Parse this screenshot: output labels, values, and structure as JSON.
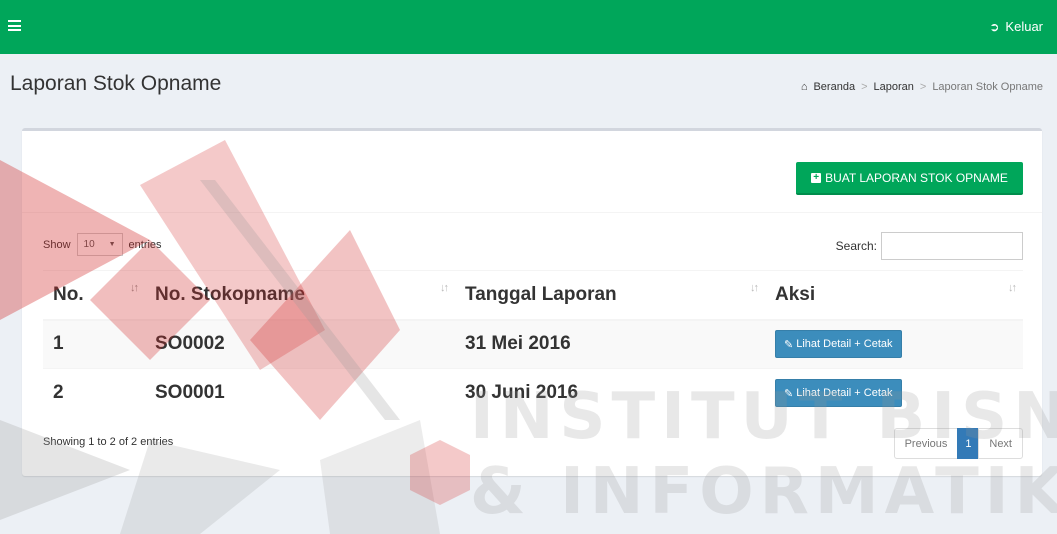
{
  "topbar": {
    "logout_label": "Keluar",
    "bg_color": "#00a65a"
  },
  "header": {
    "title": "Laporan Stok Opname",
    "breadcrumb": [
      {
        "label": "Beranda",
        "icon": "home-icon"
      },
      {
        "label": "Laporan"
      },
      {
        "label": "Laporan Stok Opname"
      }
    ]
  },
  "toolbar": {
    "create_label": "BUAT LAPORAN STOK OPNAME"
  },
  "controls": {
    "show_label": "Show",
    "length_value": "10",
    "entries_label": "entries",
    "search_label": "Search:",
    "search_value": ""
  },
  "table": {
    "columns": [
      "No.",
      "No. Stokopname",
      "Tanggal Laporan",
      "Aksi"
    ],
    "rows": [
      {
        "no": "1",
        "code": "SO0002",
        "date": "31 Mei 2016",
        "action": "Lihat Detail + Cetak"
      },
      {
        "no": "2",
        "code": "SO0001",
        "date": "30 Juni 2016",
        "action": "Lihat Detail + Cetak"
      }
    ]
  },
  "footer": {
    "info": "Showing 1 to 2 of 2 entries",
    "prev_label": "Previous",
    "current_page": "1",
    "next_label": "Next"
  },
  "watermark": {
    "line1": "INSTITUT BISNIS",
    "line2": "& INFORMATIKA"
  },
  "colors": {
    "accent_green": "#00a65a",
    "button_blue": "#3c8dbc",
    "page_blue": "#337ab7"
  }
}
